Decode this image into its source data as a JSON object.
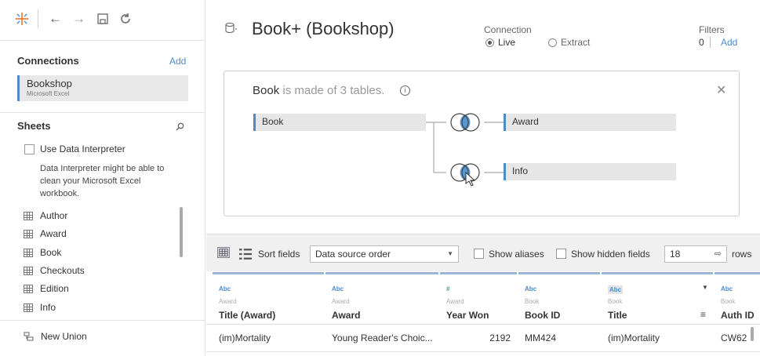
{
  "toolbar": {
    "icons": [
      "tableau-logo-icon",
      "back-arrow-icon",
      "forward-arrow-icon",
      "save-icon",
      "refresh-icon"
    ]
  },
  "connections": {
    "title": "Connections",
    "add_label": "Add",
    "items": [
      {
        "name": "Bookshop",
        "type": "Microsoft Excel"
      }
    ]
  },
  "sheets": {
    "title": "Sheets",
    "interpreter_label": "Use Data Interpreter",
    "interpreter_desc_1": "Data Interpreter might be able to",
    "interpreter_desc_2": "clean your Microsoft Excel",
    "interpreter_desc_3": "workbook.",
    "items": [
      "Author",
      "Award",
      "Book",
      "Checkouts",
      "Edition",
      "Info"
    ],
    "new_union": "New Union"
  },
  "datasource": {
    "title": "Book+ (Bookshop)",
    "connection_label": "Connection",
    "live_label": "Live",
    "extract_label": "Extract",
    "connection_selected": "Live",
    "filters_label": "Filters",
    "filters_count": "0",
    "filters_add": "Add"
  },
  "canvas": {
    "made_of_table": "Book",
    "made_of_text": " is made of 3 tables.",
    "tables": [
      "Book",
      "Award",
      "Info"
    ]
  },
  "grid_toolbar": {
    "sort_label": "Sort fields",
    "sort_value": "Data source order",
    "show_aliases": "Show aliases",
    "show_hidden": "Show hidden fields",
    "rows_value": "18",
    "rows_label": "rows"
  },
  "grid": {
    "columns": [
      {
        "type": "Abc",
        "source": "Award",
        "name": "Title (Award)",
        "value": "(im)Mortality"
      },
      {
        "type": "Abc",
        "source": "Award",
        "name": "Award",
        "value": "Young Reader's Choic..."
      },
      {
        "type": "#",
        "source": "Award",
        "name": "Year Won",
        "value": "2192"
      },
      {
        "type": "Abc",
        "source": "Book",
        "name": "Book ID",
        "value": "MM424"
      },
      {
        "type": "Abc",
        "source": "Book",
        "name": "Title",
        "value": "(im)Mortality"
      },
      {
        "type": "Abc",
        "source": "Book",
        "name": "Auth ID",
        "value": "CW62"
      }
    ]
  },
  "colors": {
    "accent": "#4e8ac8",
    "toolbar_bg": "#f0f0f0",
    "selected_bg": "#e8e8e8"
  }
}
